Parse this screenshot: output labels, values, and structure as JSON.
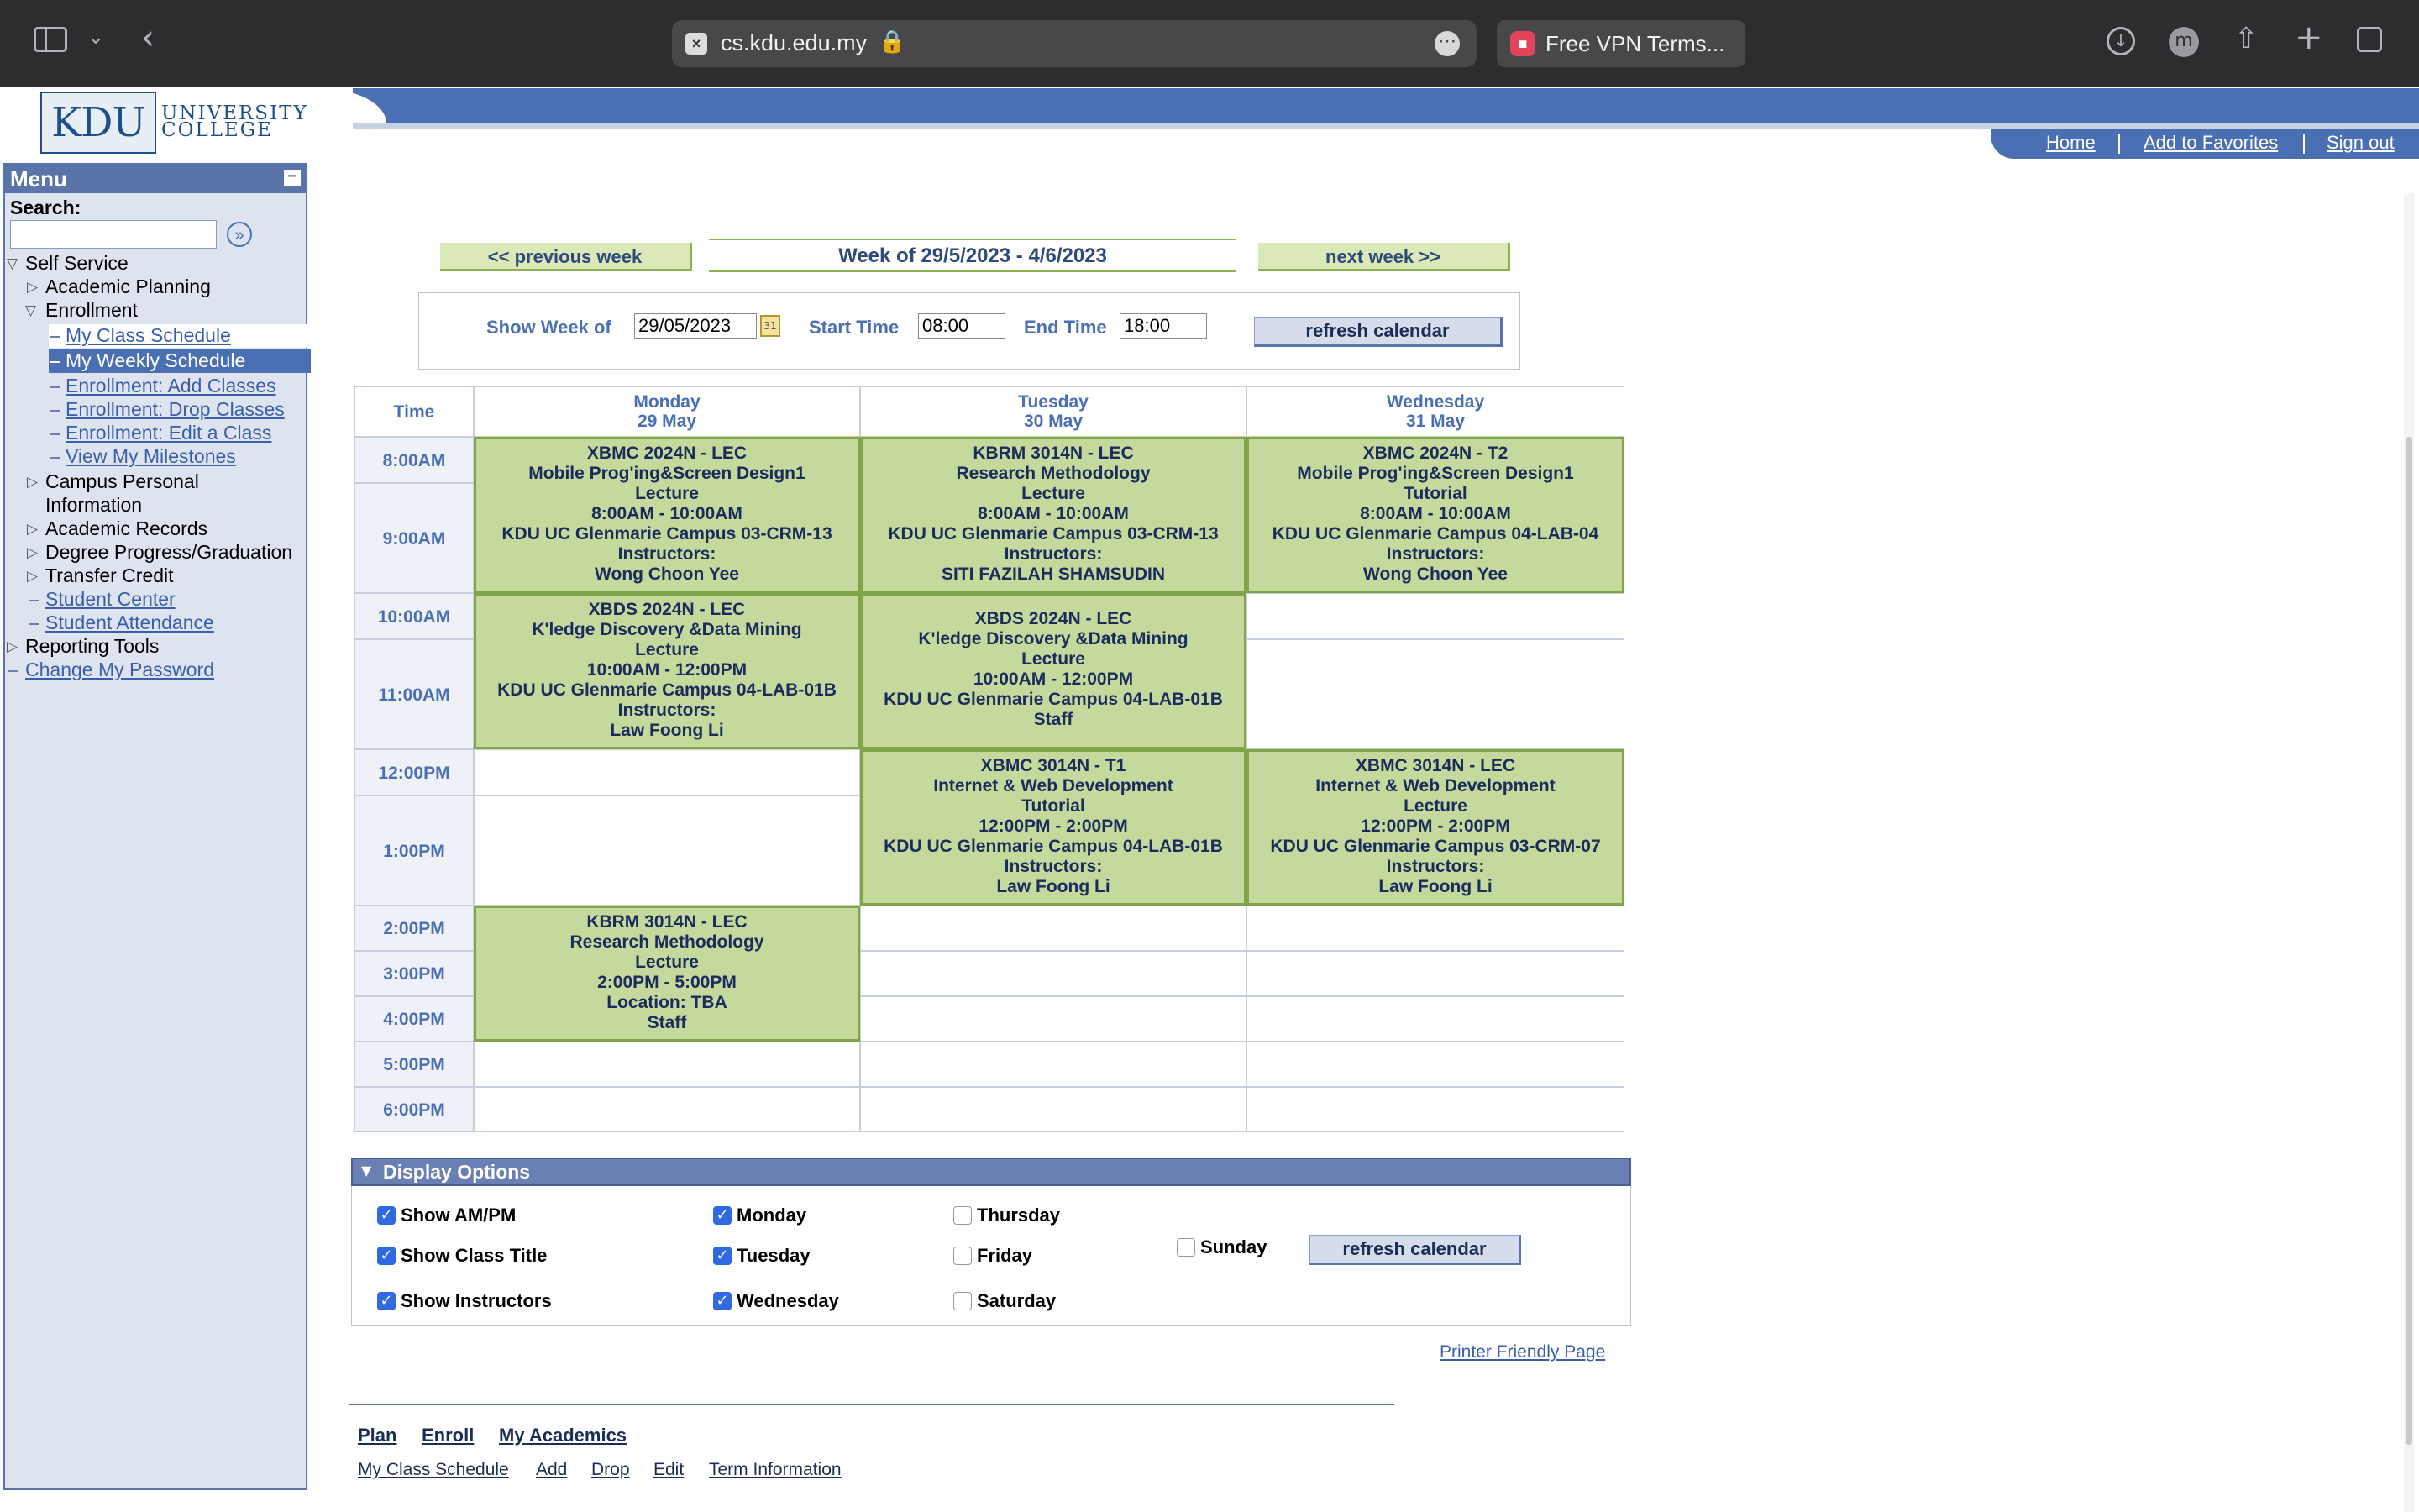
{
  "browser": {
    "url": "cs.kdu.edu.my",
    "tab_label": "Free VPN Terms...",
    "profile_initial": "m"
  },
  "header": {
    "logo_letters": "KDU",
    "logo_line1": "UNIVERSITY",
    "logo_line2": "COLLEGE",
    "links": [
      "Home",
      "Add to Favorites",
      "Sign out"
    ]
  },
  "menu": {
    "title": "Menu",
    "search_label": "Search:",
    "items": [
      "Self Service",
      "Academic Planning",
      "Enrollment",
      "My Class Schedule",
      "My Weekly Schedule",
      "Enrollment: Add Classes",
      "Enrollment: Drop Classes",
      "Enrollment: Edit a Class",
      "View My Milestones",
      "Campus Personal",
      "Information",
      "Academic Records",
      "Degree Progress/Graduation",
      "Transfer Credit",
      "Student Center",
      "Student Attendance",
      "Reporting Tools",
      "Change My Password"
    ]
  },
  "week_nav": {
    "prev": "<< previous week",
    "current": "Week of 29/5/2023 - 4/6/2023",
    "next": "next week >>"
  },
  "week_form": {
    "show_week_label": "Show Week of",
    "show_week_value": "29/05/2023",
    "start_label": "Start Time",
    "start_value": "08:00",
    "end_label": "End Time",
    "end_value": "18:00",
    "refresh": "refresh calendar"
  },
  "calendar": {
    "time_header": "Time",
    "days": [
      {
        "name": "Monday",
        "date": "29 May"
      },
      {
        "name": "Tuesday",
        "date": "30 May"
      },
      {
        "name": "Wednesday",
        "date": "31 May"
      }
    ],
    "times": [
      "8:00AM",
      "9:00AM",
      "10:00AM",
      "11:00AM",
      "12:00PM",
      "1:00PM",
      "2:00PM",
      "3:00PM",
      "4:00PM",
      "5:00PM",
      "6:00PM"
    ],
    "events": [
      {
        "lines": [
          "XBMC 2024N - LEC",
          "Mobile Prog'ing&Screen Design1",
          "Lecture",
          "8:00AM - 10:00AM",
          "KDU UC Glenmarie Campus 03-CRM-13",
          "Instructors:",
          "Wong Choon Yee"
        ]
      },
      {
        "lines": [
          "KBRM 3014N - LEC",
          "Research Methodology",
          "Lecture",
          "8:00AM - 10:00AM",
          "KDU UC Glenmarie Campus 03-CRM-13",
          "Instructors:",
          "SITI FAZILAH SHAMSUDIN"
        ]
      },
      {
        "lines": [
          "XBMC 2024N - T2",
          "Mobile Prog'ing&Screen Design1",
          "Tutorial",
          "8:00AM - 10:00AM",
          "KDU UC Glenmarie Campus 04-LAB-04",
          "Instructors:",
          "Wong Choon Yee"
        ]
      },
      {
        "lines": [
          "XBDS 2024N - LEC",
          "K'ledge Discovery &Data Mining",
          "Lecture",
          "10:00AM - 12:00PM",
          "KDU UC Glenmarie Campus 04-LAB-01B",
          "Instructors:",
          "Law Foong Li"
        ]
      },
      {
        "lines": [
          "XBDS 2024N - LEC",
          "K'ledge Discovery &Data Mining",
          "Lecture",
          "10:00AM - 12:00PM",
          "KDU UC Glenmarie Campus 04-LAB-01B",
          "Staff"
        ]
      },
      {
        "lines": [
          "XBMC 3014N - T1",
          "Internet & Web Development",
          "Tutorial",
          "12:00PM - 2:00PM",
          "KDU UC Glenmarie Campus 04-LAB-01B",
          "Instructors:",
          "Law Foong Li"
        ]
      },
      {
        "lines": [
          "XBMC 3014N - LEC",
          "Internet & Web Development",
          "Lecture",
          "12:00PM - 2:00PM",
          "KDU UC Glenmarie Campus 03-CRM-07",
          "Instructors:",
          "Law Foong Li"
        ]
      },
      {
        "lines": [
          "KBRM 3014N - LEC",
          "Research Methodology",
          "Lecture",
          "2:00PM - 5:00PM",
          "Location: TBA",
          "Staff"
        ]
      }
    ]
  },
  "display_options": {
    "title": "Display Options",
    "options": [
      "Show AM/PM",
      "Show Class Title",
      "Show Instructors",
      "Monday",
      "Tuesday",
      "Wednesday",
      "Thursday",
      "Friday",
      "Saturday",
      "Sunday"
    ],
    "checked": [
      true,
      true,
      true,
      true,
      true,
      true,
      false,
      false,
      false,
      false
    ],
    "refresh": "refresh calendar"
  },
  "printer_link": "Printer Friendly Page",
  "footer": {
    "tabs": [
      "Plan",
      "Enroll",
      "My Academics"
    ],
    "links": [
      "My Class Schedule",
      "Add",
      "Drop",
      "Edit",
      "Term Information"
    ]
  }
}
